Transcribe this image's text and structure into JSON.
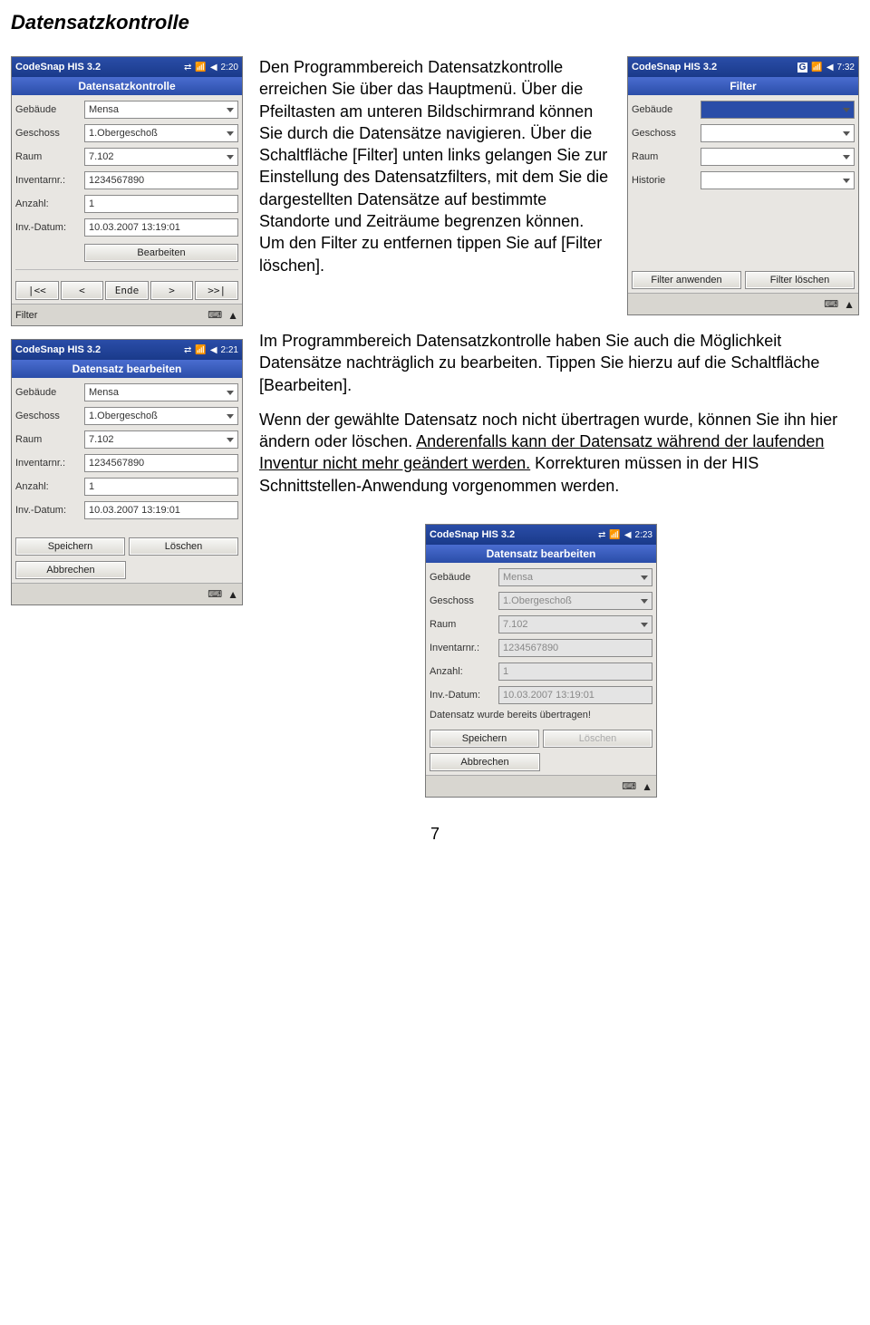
{
  "heading": "Datensatzkontrolle",
  "paragraphs": {
    "p1": "Den Programmbereich Datensatzkontrolle erreichen Sie über das Hauptmenü. Über die Pfeiltasten am unteren Bildschirmrand können Sie durch die Datensätze navigieren. Über die Schaltfläche [Filter] unten links gelangen Sie zur Einstellung des Datensatzfilters, mit dem Sie die dargestellten Datensätze auf bestimmte Standorte und Zeiträume begrenzen können. Um den Filter zu entfernen tippen Sie auf [Filter löschen].",
    "p2": "Im Programmbereich Datensatzkontrolle haben Sie auch die Möglichkeit Datensätze nachträglich zu bearbeiten. Tippen Sie hierzu auf die Schaltfläche [Bearbeiten].",
    "p3a": "Wenn der gewählte Datensatz noch nicht übertragen wurde, können Sie ihn hier ändern oder löschen. ",
    "p3b": "Anderenfalls kann der Datensatz während der laufenden Inventur nicht mehr geändert werden.",
    "p3c": " Korrekturen müssen in der HIS Schnittstellen-Anwendung vorgenommen werden."
  },
  "labels": {
    "gebaeude": "Gebäude",
    "geschoss": "Geschoss",
    "raum": "Raum",
    "inventarnr": "Inventarnr.:",
    "anzahl": "Anzahl:",
    "invdatum": "Inv.-Datum:",
    "historie": "Historie"
  },
  "buttons": {
    "bearbeiten": "Bearbeiten",
    "speichern": "Speichern",
    "loeschen": "Löschen",
    "abbrechen": "Abbrechen",
    "ende": "Ende",
    "nav_first": "|<<",
    "nav_prev": "<",
    "nav_next": ">",
    "nav_last": ">>|",
    "filter": "Filter",
    "filter_anwenden": "Filter anwenden",
    "filter_loeschen": "Filter löschen"
  },
  "screenshots": {
    "s1": {
      "app": "CodeSnap HIS 3.2",
      "time": "2:20",
      "title": "Datensatzkontrolle",
      "gebaeude": "Mensa",
      "geschoss": "1.Obergeschoß",
      "raum": "7.102",
      "inventarnr": "1234567890",
      "anzahl": "1",
      "invdatum": "10.03.2007 13:19:01",
      "bottom_label": "Filter"
    },
    "s2": {
      "app": "CodeSnap HIS 3.2",
      "time": "2:21",
      "title": "Datensatz bearbeiten",
      "gebaeude": "Mensa",
      "geschoss": "1.Obergeschoß",
      "raum": "7.102",
      "inventarnr": "1234567890",
      "anzahl": "1",
      "invdatum": "10.03.2007 13:19:01"
    },
    "s3": {
      "app": "CodeSnap HIS 3.2",
      "time": "7:32",
      "title": "Filter",
      "gebaeude": "",
      "geschoss": "",
      "raum": "",
      "historie": ""
    },
    "s4": {
      "app": "CodeSnap HIS 3.2",
      "time": "2:23",
      "title": "Datensatz bearbeiten",
      "gebaeude": "Mensa",
      "geschoss": "1.Obergeschoß",
      "raum": "7.102",
      "inventarnr": "1234567890",
      "anzahl": "1",
      "invdatum": "10.03.2007 13:19:01",
      "info": "Datensatz wurde bereits übertragen!"
    }
  },
  "page_number": "7"
}
